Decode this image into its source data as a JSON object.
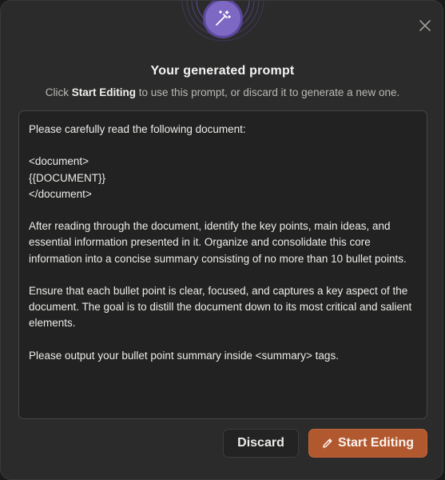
{
  "dialog": {
    "title": "Your generated prompt",
    "subtitle_prefix": "Click ",
    "subtitle_emphasis": "Start Editing",
    "subtitle_suffix": " to use this prompt, or discard it to generate a new one.",
    "icon": "magic-wand-icon",
    "close_icon": "close-icon"
  },
  "prompt": {
    "text": "Please carefully read the following document:\n\n<document>\n{{DOCUMENT}}\n</document>\n\nAfter reading through the document, identify the key points, main ideas, and essential information presented in it. Organize and consolidate this core information into a concise summary consisting of no more than 10 bullet points.\n\nEnsure that each bullet point is clear, focused, and captures a key aspect of the document. The goal is to distill the document down to its most critical and salient elements.\n\nPlease output your bullet point summary inside <summary> tags."
  },
  "actions": {
    "discard_label": "Discard",
    "start_editing_label": "Start Editing",
    "start_editing_icon": "pencil-icon"
  },
  "colors": {
    "accent": "#b2582f",
    "badge": "#7d68c3",
    "background": "#2b2b2b"
  }
}
